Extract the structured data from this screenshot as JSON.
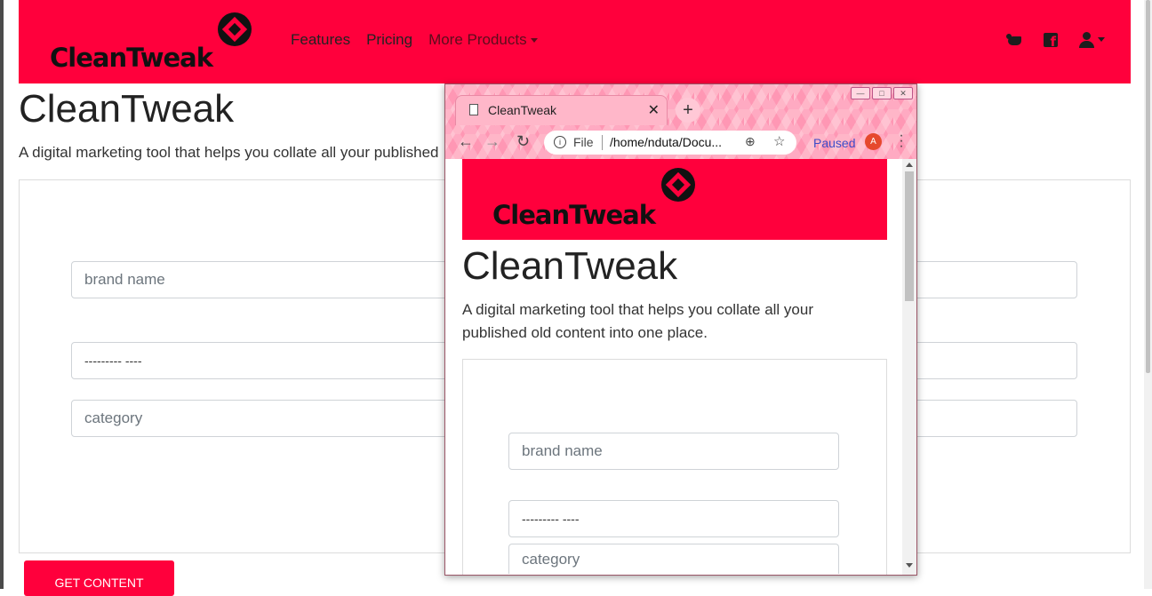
{
  "main": {
    "brand": "CleanTweak",
    "nav": {
      "features": "Features",
      "pricing": "Pricing",
      "more_products": "More Products"
    },
    "title": "CleanTweak",
    "subtitle": "A digital marketing tool that helps you collate all your published",
    "form": {
      "brand_placeholder": "brand name",
      "select_value": "--------- ----",
      "category_placeholder": "category"
    },
    "submit_label": "GET CONTENT"
  },
  "popup": {
    "tab_title": "CleanTweak",
    "url_scheme": "File",
    "url": "/home/nduta/Docu...",
    "profile_status": "Paused",
    "profile_initial": "A",
    "page": {
      "brand": "CleanTweak",
      "title": "CleanTweak",
      "subtitle": "A digital marketing tool that helps you collate all your published old content into one place.",
      "brand_placeholder": "brand name",
      "select_value": "--------- ----",
      "category_placeholder": "category"
    }
  },
  "colors": {
    "brand_red": "#ff003c",
    "text_dark": "#222222"
  },
  "icons": [
    "twitter-icon",
    "facebook-icon",
    "user-icon",
    "document-icon",
    "info-icon",
    "zoom-icon",
    "star-icon",
    "kebab-menu-icon"
  ]
}
